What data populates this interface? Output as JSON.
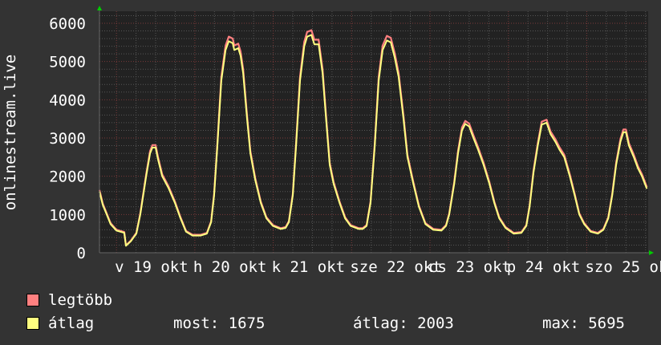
{
  "chart_data": {
    "type": "line",
    "ylabel": "onlinestream.live",
    "ylim": [
      0,
      6000
    ],
    "yticks": [
      0,
      1000,
      2000,
      3000,
      4000,
      5000,
      6000
    ],
    "xlim_hours": [
      0,
      168
    ],
    "first_day_boundary_hour": 5.2,
    "xtick_labels": [
      "v 19 okt",
      "h 20 okt",
      "k 21 okt",
      "sze 22 okt",
      "cs 23 okt",
      "p 24 okt",
      "szo 25 okt"
    ],
    "grid": true,
    "colors": {
      "max": "#ff8080",
      "avg": "#ffff80",
      "grid_major": "#7a3a3a",
      "grid_minor": "#555555",
      "arrow": "#00cc00"
    },
    "series": [
      {
        "name": "legtöbb",
        "color": "#ff8080"
      },
      {
        "name": "átlag",
        "color": "#ffff80",
        "points": [
          [
            0,
            1600
          ],
          [
            1,
            1250
          ],
          [
            2.2,
            1000
          ],
          [
            3.4,
            750
          ],
          [
            5.2,
            580
          ],
          [
            7.6,
            520
          ],
          [
            8.1,
            180
          ],
          [
            9.6,
            300
          ],
          [
            11.3,
            500
          ],
          [
            12.5,
            1000
          ],
          [
            14.3,
            2000
          ],
          [
            15.5,
            2600
          ],
          [
            16.2,
            2750
          ],
          [
            17.2,
            2750
          ],
          [
            17.9,
            2450
          ],
          [
            19.2,
            2000
          ],
          [
            21.1,
            1700
          ],
          [
            23.1,
            1300
          ],
          [
            24.8,
            900
          ],
          [
            26.5,
            550
          ],
          [
            28.5,
            450
          ],
          [
            31,
            450
          ],
          [
            32.9,
            500
          ],
          [
            34.2,
            800
          ],
          [
            35.1,
            1500
          ],
          [
            36.1,
            2800
          ],
          [
            37.3,
            4500
          ],
          [
            38.6,
            5300
          ],
          [
            39.6,
            5530
          ],
          [
            40.8,
            5480
          ],
          [
            41.3,
            5300
          ],
          [
            42.5,
            5350
          ],
          [
            43.2,
            5150
          ],
          [
            44,
            4700
          ],
          [
            45.2,
            3500
          ],
          [
            46.2,
            2600
          ],
          [
            47.7,
            1900
          ],
          [
            49.4,
            1300
          ],
          [
            51.1,
            900
          ],
          [
            53.1,
            700
          ],
          [
            55.5,
            620
          ],
          [
            57,
            650
          ],
          [
            58,
            800
          ],
          [
            59.2,
            1500
          ],
          [
            60.2,
            2800
          ],
          [
            61.4,
            4500
          ],
          [
            62.7,
            5400
          ],
          [
            63.6,
            5650
          ],
          [
            64.9,
            5695
          ],
          [
            65.8,
            5450
          ],
          [
            67.1,
            5450
          ],
          [
            68.3,
            4700
          ],
          [
            69.3,
            3600
          ],
          [
            70.5,
            2300
          ],
          [
            71.7,
            1800
          ],
          [
            73.5,
            1300
          ],
          [
            75.2,
            900
          ],
          [
            76.9,
            700
          ],
          [
            79.4,
            620
          ],
          [
            80.6,
            620
          ],
          [
            81.8,
            700
          ],
          [
            83,
            1300
          ],
          [
            84.3,
            2800
          ],
          [
            85.5,
            4500
          ],
          [
            86.7,
            5300
          ],
          [
            88,
            5550
          ],
          [
            89.2,
            5500
          ],
          [
            90.4,
            5100
          ],
          [
            91.6,
            4600
          ],
          [
            93.1,
            3500
          ],
          [
            94.3,
            2500
          ],
          [
            96.1,
            1800
          ],
          [
            97.8,
            1200
          ],
          [
            99.8,
            750
          ],
          [
            102.2,
            600
          ],
          [
            104.7,
            580
          ],
          [
            106.1,
            700
          ],
          [
            107.1,
            1000
          ],
          [
            108.6,
            1800
          ],
          [
            109.8,
            2600
          ],
          [
            111,
            3200
          ],
          [
            112,
            3370
          ],
          [
            113.2,
            3300
          ],
          [
            114.5,
            3000
          ],
          [
            115.9,
            2700
          ],
          [
            117.6,
            2300
          ],
          [
            119.4,
            1800
          ],
          [
            120.9,
            1300
          ],
          [
            122.4,
            900
          ],
          [
            124.3,
            650
          ],
          [
            126.8,
            500
          ],
          [
            129.2,
            520
          ],
          [
            130.7,
            700
          ],
          [
            131.7,
            1200
          ],
          [
            132.9,
            2100
          ],
          [
            134.2,
            2800
          ],
          [
            135.4,
            3350
          ],
          [
            136.9,
            3400
          ],
          [
            138.1,
            3100
          ],
          [
            139.6,
            2900
          ],
          [
            140.8,
            2700
          ],
          [
            142.3,
            2500
          ],
          [
            144,
            2000
          ],
          [
            145.5,
            1500
          ],
          [
            146.9,
            1000
          ],
          [
            148.4,
            750
          ],
          [
            150.4,
            550
          ],
          [
            152.6,
            500
          ],
          [
            154.3,
            600
          ],
          [
            155.8,
            900
          ],
          [
            157,
            1500
          ],
          [
            158.2,
            2300
          ],
          [
            159.5,
            2900
          ],
          [
            160.4,
            3150
          ],
          [
            161.2,
            3150
          ],
          [
            162.1,
            2800
          ],
          [
            163.6,
            2500
          ],
          [
            164.9,
            2200
          ],
          [
            166.1,
            2000
          ],
          [
            167.6,
            1675
          ]
        ]
      }
    ]
  },
  "legend": {
    "max_label": "legtöbb",
    "avg_label": "átlag",
    "now": "most: 1675",
    "average": "átlag: 2003",
    "maximum": "max: 5695"
  }
}
